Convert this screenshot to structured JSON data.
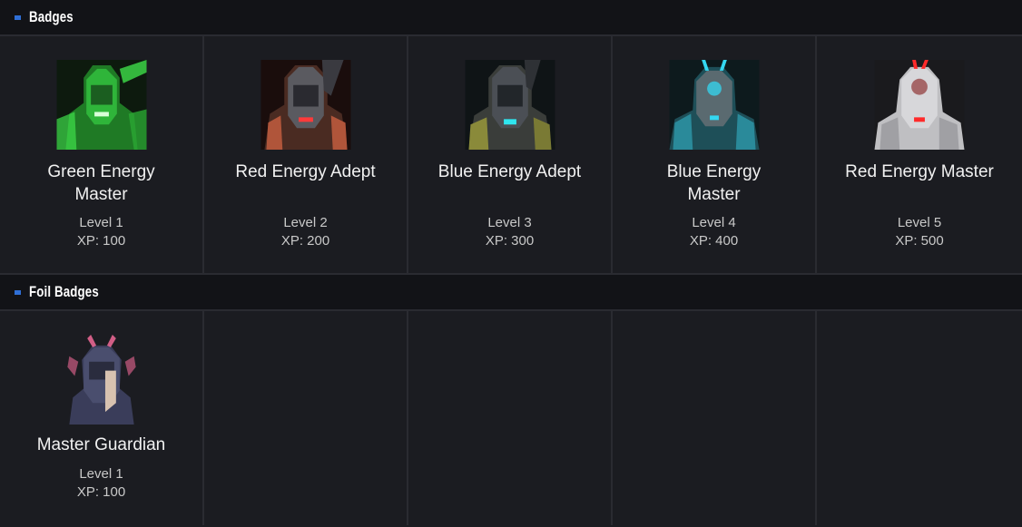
{
  "sections": {
    "badges": {
      "title": "Badges",
      "items": [
        {
          "name": "Green Energy Master",
          "level": "Level 1",
          "xp": "XP: 100",
          "icon": "green-energy-master-icon",
          "glow": "#3fe04a"
        },
        {
          "name": "Red Energy Adept",
          "level": "Level 2",
          "xp": "XP: 200",
          "icon": "red-energy-adept-icon",
          "glow": "#ff3a3a"
        },
        {
          "name": "Blue Energy Adept",
          "level": "Level 3",
          "xp": "XP: 300",
          "icon": "blue-energy-adept-icon",
          "glow": "#2fe6f0"
        },
        {
          "name": "Blue Energy Master",
          "level": "Level 4",
          "xp": "XP: 400",
          "icon": "blue-energy-master-icon",
          "glow": "#34d8f2"
        },
        {
          "name": "Red Energy Master",
          "level": "Level 5",
          "xp": "XP: 500",
          "icon": "red-energy-master-icon",
          "glow": "#ff2a2a"
        }
      ]
    },
    "foil_badges": {
      "title": "Foil Badges",
      "items": [
        {
          "name": "Master Guardian",
          "level": "Level 1",
          "xp": "XP: 100",
          "icon": "master-guardian-icon",
          "glow": "#ff6fa0"
        }
      ]
    }
  },
  "colors": {
    "background": "#1b1c21",
    "header": "#121317",
    "accent": "#2f6fd6",
    "divider": "#2a2b31"
  }
}
